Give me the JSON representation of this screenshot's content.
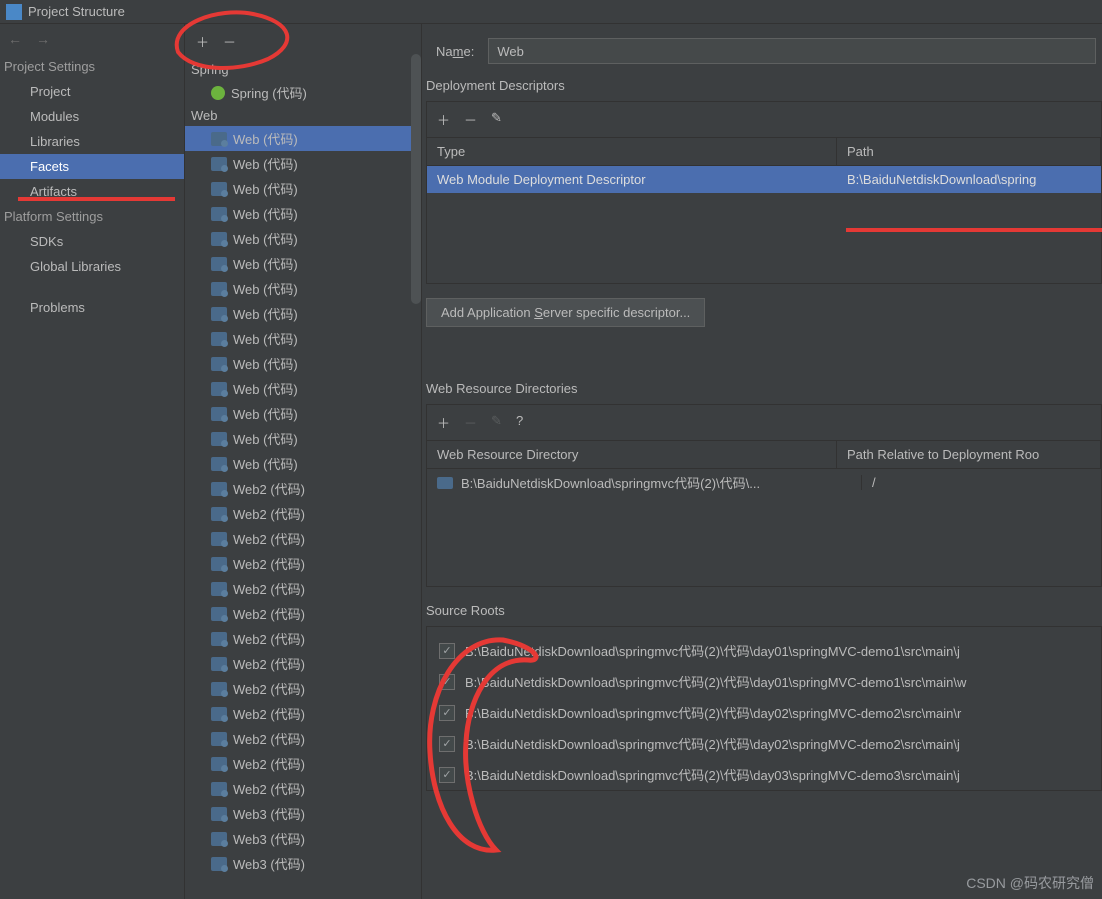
{
  "window": {
    "title": "Project Structure"
  },
  "leftNav": {
    "projectSettingsHeader": "Project Settings",
    "project": "Project",
    "modules": "Modules",
    "libraries": "Libraries",
    "facets": "Facets",
    "artifacts": "Artifacts",
    "platformSettingsHeader": "Platform Settings",
    "sdks": "SDKs",
    "globalLibraries": "Global Libraries",
    "problems": "Problems"
  },
  "facetTree": {
    "spring": "Spring",
    "springChild": "Spring (代码)",
    "web": "Web",
    "items": [
      "Web (代码)",
      "Web (代码)",
      "Web (代码)",
      "Web (代码)",
      "Web (代码)",
      "Web (代码)",
      "Web (代码)",
      "Web (代码)",
      "Web (代码)",
      "Web (代码)",
      "Web (代码)",
      "Web (代码)",
      "Web (代码)",
      "Web (代码)",
      "Web2 (代码)",
      "Web2 (代码)",
      "Web2 (代码)",
      "Web2 (代码)",
      "Web2 (代码)",
      "Web2 (代码)",
      "Web2 (代码)",
      "Web2 (代码)",
      "Web2 (代码)",
      "Web2 (代码)",
      "Web2 (代码)",
      "Web2 (代码)",
      "Web2 (代码)",
      "Web3 (代码)",
      "Web3 (代码)",
      "Web3 (代码)"
    ]
  },
  "form": {
    "nameLabel": "Name:",
    "nameValue": "Web",
    "deployHeader": "Deployment Descriptors",
    "typeHeader": "Type",
    "pathHeader": "Path",
    "deployType": "Web Module Deployment Descriptor",
    "deployPath": "B:\\BaiduNetdiskDownload\\spring",
    "addServerBtn": "Add Application Server specific descriptor...",
    "wrHeader": "Web Resource Directories",
    "wrDirHeader": "Web Resource Directory",
    "wrRelHeader": "Path Relative to Deployment Roo",
    "wrDir": "B:\\BaiduNetdiskDownload\\springmvc代码(2)\\代码\\...",
    "wrRel": "/",
    "sourceHeader": "Source Roots",
    "sources": [
      "B:\\BaiduNetdiskDownload\\springmvc代码(2)\\代码\\day01\\springMVC-demo1\\src\\main\\j",
      "B:\\BaiduNetdiskDownload\\springmvc代码(2)\\代码\\day01\\springMVC-demo1\\src\\main\\w",
      "B:\\BaiduNetdiskDownload\\springmvc代码(2)\\代码\\day02\\springMVC-demo2\\src\\main\\r",
      "B:\\BaiduNetdiskDownload\\springmvc代码(2)\\代码\\day02\\springMVC-demo2\\src\\main\\j",
      "B:\\BaiduNetdiskDownload\\springmvc代码(2)\\代码\\day03\\springMVC-demo3\\src\\main\\j"
    ]
  },
  "watermark": "CSDN @码农研究僧"
}
